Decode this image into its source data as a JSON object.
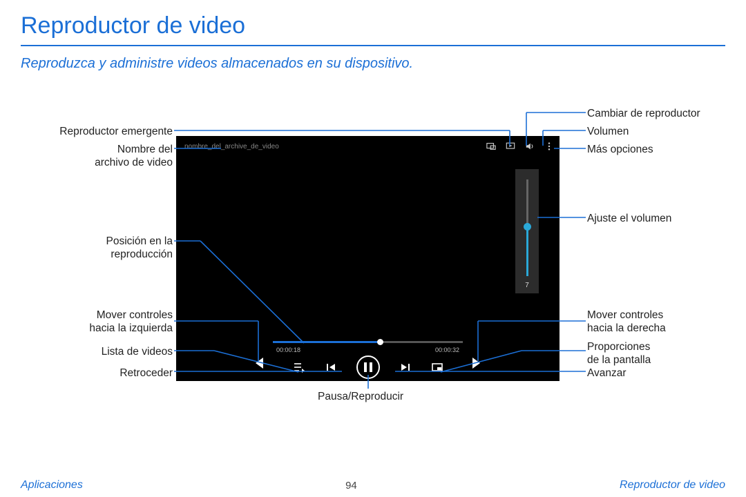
{
  "title": "Reproductor de video",
  "subtitle": "Reproduzca y administre videos almacenados en su dispositivo.",
  "player": {
    "filename": "nombre_del_archive_de_video",
    "time_current": "00:00:18",
    "time_total": "00:00:32",
    "volume_value": "7"
  },
  "callouts": {
    "popup_player": "Reproductor emergente",
    "filename": "Nombre del\narchivo de video",
    "position": "Posición en la\nreproducción",
    "move_left": "Mover controles\nhacia la izquierda",
    "video_list": "Lista de videos",
    "rewind": "Retroceder",
    "play_pause": "Pausa/Reproducir",
    "switch_player": "Cambiar de reproductor",
    "volume": "Volumen",
    "more_options": "Más opciones",
    "adjust_volume": "Ajuste el volumen",
    "move_right": "Mover controles\nhacia la derecha",
    "aspect_ratio": "Proporciones\nde la pantalla",
    "forward": "Avanzar"
  },
  "footer": {
    "left": "Aplicaciones",
    "page": "94",
    "right": "Reproductor de video"
  }
}
